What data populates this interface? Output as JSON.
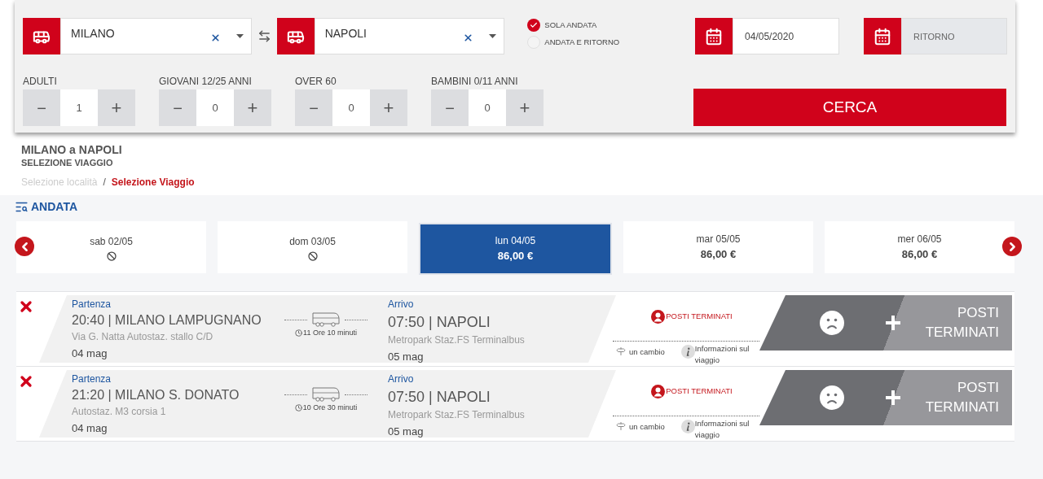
{
  "search": {
    "from": {
      "value": "MILANO"
    },
    "to": {
      "value": "NAPOLI"
    },
    "trip_type": [
      {
        "label": "SOLA ANDATA",
        "selected": true
      },
      {
        "label": "ANDATA E RITORNO",
        "selected": false
      }
    ],
    "departure_date": {
      "value": "04/05/2020"
    },
    "return_date": {
      "placeholder": "RITORNO"
    },
    "passengers": [
      {
        "label": "ADULTI",
        "value": "1",
        "minus": "−",
        "plus": "+"
      },
      {
        "label": "GIOVANI 12/25 ANNI",
        "value": "0",
        "minus": "−",
        "plus": "+"
      },
      {
        "label": "OVER 60",
        "value": "0",
        "minus": "−",
        "plus": "+"
      },
      {
        "label": "BAMBINI 0/11 ANNI",
        "value": "0",
        "minus": "−",
        "plus": "+"
      }
    ],
    "button": "CERCA"
  },
  "heading": {
    "title": "MILANO a NAPOLI",
    "subtitle": "SELEZIONE VIAGGIO"
  },
  "breadcrumb": [
    {
      "label": "Selezione località",
      "selected": false
    },
    {
      "label": "Selezione Viaggio",
      "selected": true
    }
  ],
  "breadcrumb_separator": "/",
  "section": {
    "title": "ANDATA"
  },
  "dates": [
    {
      "day": "sab 02/05",
      "kind": "unavailable",
      "selected": false
    },
    {
      "day": "dom 03/05",
      "kind": "unavailable",
      "selected": false
    },
    {
      "day": "lun 04/05",
      "kind": "price",
      "price": "86,00 €",
      "selected": true
    },
    {
      "day": "mar 05/05",
      "kind": "price",
      "price": "86,00 €",
      "selected": false
    },
    {
      "day": "mer 06/05",
      "kind": "price",
      "price": "86,00 €",
      "selected": false
    }
  ],
  "trips": [
    {
      "departure_label": "Partenza",
      "departure": "20:40 | MILANO LAMPUGNANO",
      "departure_address": "Via G. Natta Autostaz. stallo C/D",
      "departure_date": "04 mag",
      "duration": "11 Ore 10 minuti",
      "arrival_label": "Arrivo",
      "arrival": "07:50 | NAPOLI",
      "arrival_address": "Metropark Staz.FS Terminalbus",
      "arrival_date": "05 mag",
      "status": "POSTI TERMINATI",
      "change": "un cambio",
      "info": "Informazioni sul viaggio",
      "button": "POSTI TERMINATI"
    },
    {
      "departure_label": "Partenza",
      "departure": "21:20 | MILANO S. DONATO",
      "departure_address": "Autostaz. M3 corsia 1",
      "departure_date": "04 mag",
      "duration": "10 Ore 30 minuti",
      "arrival_label": "Arrivo",
      "arrival": "07:50 | NAPOLI",
      "arrival_address": "Metropark Staz.FS Terminalbus",
      "arrival_date": "05 mag",
      "status": "POSTI TERMINATI",
      "change": "un cambio",
      "info": "Informazioni sul viaggio",
      "button": "POSTI TERMINATI"
    }
  ]
}
